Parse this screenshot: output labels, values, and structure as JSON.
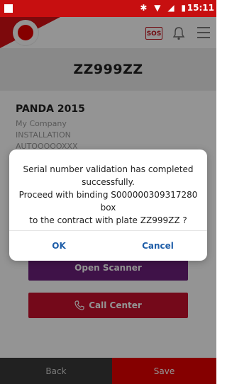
{
  "status_bar": {
    "time": "15:11",
    "icons": [
      "bluetooth-icon",
      "wifi-icon",
      "signal-icon",
      "battery-icon"
    ]
  },
  "header": {
    "sos_label": "SOS",
    "icons": [
      "vodafone-logo",
      "bell-icon",
      "menu-icon"
    ],
    "brand_color": "#e60000"
  },
  "page": {
    "plate_title": "ZZ999ZZ",
    "vehicle": {
      "name": "PANDA 2015",
      "company": "My Company",
      "status": "INSTALLATION",
      "code": "AUTOOOOOXXX"
    },
    "buttons": {
      "scanner_label": "Open Scanner",
      "call_center_label": "Call Center"
    },
    "bottom": {
      "back_label": "Back",
      "save_label": "Save"
    }
  },
  "dialog": {
    "message_line1": "Serial number validation has completed",
    "message_line2": "successfully.",
    "message_line3": "Proceed with binding S000000309317280 box",
    "message_line4": "to the contract with plate ZZ999ZZ ?",
    "ok_label": "OK",
    "cancel_label": "Cancel",
    "button_color": "#1f5ea8"
  }
}
